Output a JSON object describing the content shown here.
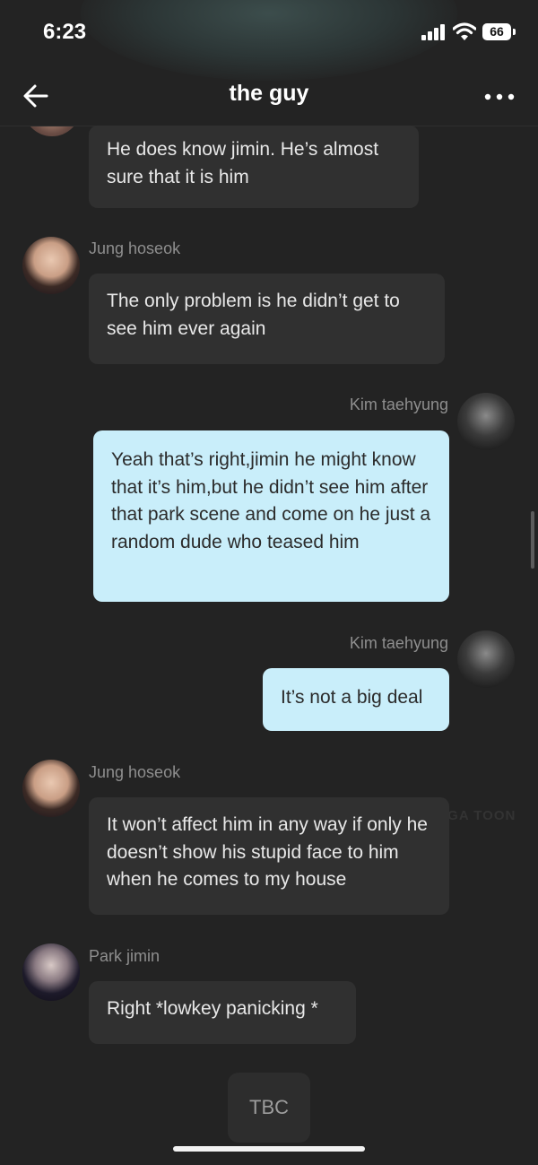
{
  "status_bar": {
    "time": "6:23",
    "battery": "66"
  },
  "header": {
    "title": "the guy"
  },
  "icons": {
    "back": "arrow-left-icon",
    "more": "more-dots-icon",
    "signal": "signal-icon",
    "wifi": "wifi-icon"
  },
  "messages": [
    {
      "sender": "",
      "text": "He does know jimin. He’s almost sure that it is him",
      "side": "left"
    },
    {
      "sender": "Jung hoseok",
      "text": "The only problem is he didn’t get to see him ever again",
      "side": "left"
    },
    {
      "sender": "Kim taehyung",
      "text": "Yeah that’s right,jimin he might know that it’s him,but he didn’t see him after that park scene and come on he just a random dude who teased him",
      "side": "right"
    },
    {
      "sender": "Kim taehyung",
      "text": "It’s not a big deal",
      "side": "right"
    },
    {
      "sender": "Jung hoseok",
      "text": "It won’t affect him in any way if only he doesn’t show his stupid face to him when he comes to my house",
      "side": "left"
    },
    {
      "sender": "Park jimin",
      "text": "Right *lowkey panicking *",
      "side": "left"
    }
  ],
  "footer": {
    "tbc_label": "TBC"
  },
  "watermark": "MANGA TOON",
  "colors": {
    "background": "#232323",
    "incoming_bubble": "#303030",
    "outgoing_bubble": "#c9eefa"
  }
}
